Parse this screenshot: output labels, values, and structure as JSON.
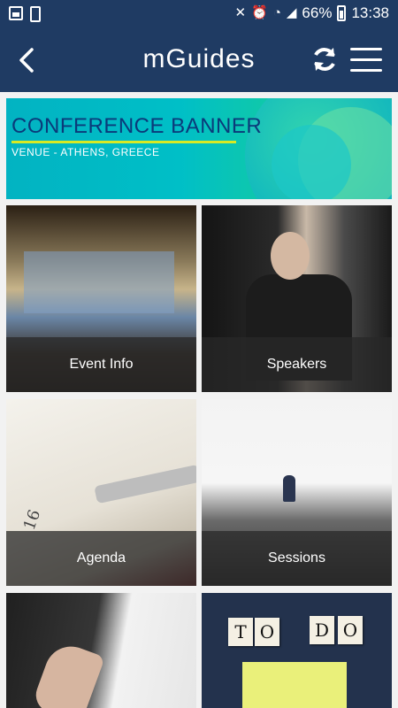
{
  "status_bar": {
    "battery": "66%",
    "time": "13:38"
  },
  "app_bar": {
    "title": "mGuides"
  },
  "banner": {
    "title": "CONFERENCE BANNER",
    "subtitle": "VENUE - ATHENS, GREECE"
  },
  "tiles": [
    {
      "label": "Event Info"
    },
    {
      "label": "Speakers"
    },
    {
      "label": "Agenda"
    },
    {
      "label": "Sessions"
    },
    {
      "label": ""
    },
    {
      "label": ""
    }
  ],
  "decor": {
    "agenda_page_number": "16",
    "todo_letters": [
      "T",
      "O",
      "D",
      "O"
    ]
  },
  "colors": {
    "app_bar": "#1f3b63",
    "banner_title": "#0b3a7a",
    "banner_accent": "#d7ea24"
  }
}
